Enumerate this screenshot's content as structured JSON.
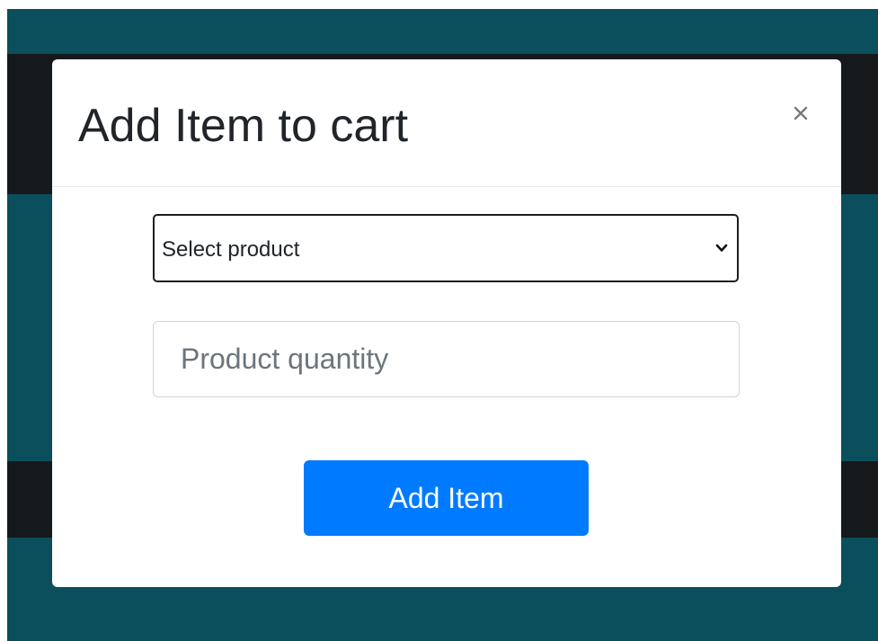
{
  "modal": {
    "title": "Add Item to cart",
    "close_label": "×"
  },
  "form": {
    "product_select": {
      "selected": "Select product",
      "icon": "chevron-down-icon"
    },
    "quantity": {
      "value": "",
      "placeholder": "Product quantity"
    },
    "submit_label": "Add Item"
  },
  "colors": {
    "backdrop": "#0a4f5b",
    "band": "#15191c",
    "primary": "#007bff",
    "title": "#212529"
  },
  "icons": {
    "close": "close-icon",
    "dropdown": "chevron-down-icon"
  }
}
